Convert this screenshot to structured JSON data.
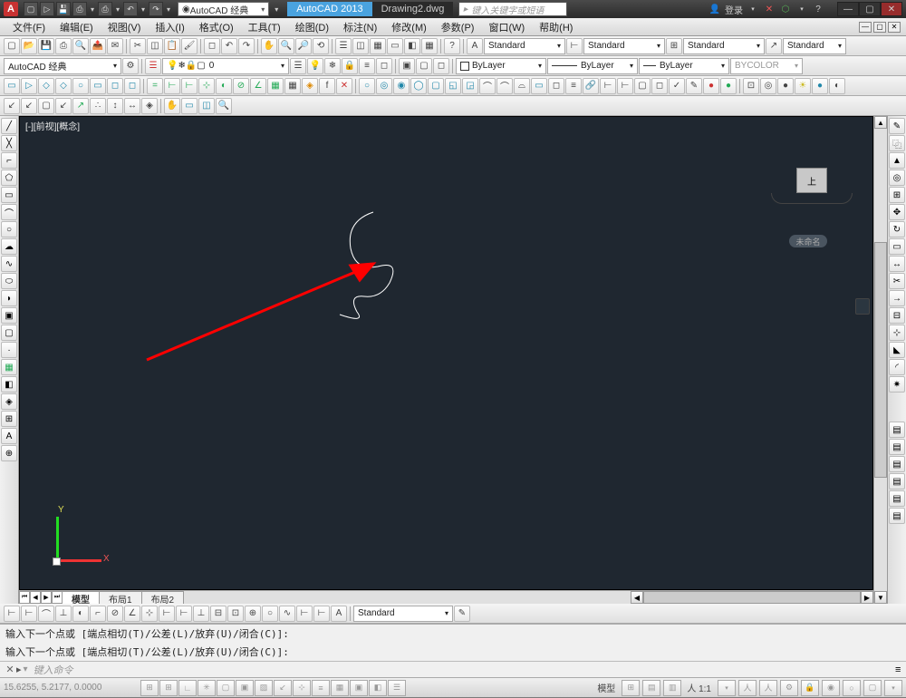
{
  "title": {
    "app": "AutoCAD 2013",
    "file": "Drawing2.dwg",
    "workspace": "AutoCAD 经典",
    "toolbar_title": "AutoCAD 经典",
    "search_placeholder": "键入关键字或短语",
    "login": "登录"
  },
  "menus": [
    "文件(F)",
    "编辑(E)",
    "视图(V)",
    "插入(I)",
    "格式(O)",
    "工具(T)",
    "绘图(D)",
    "标注(N)",
    "修改(M)",
    "参数(P)",
    "窗口(W)",
    "帮助(H)"
  ],
  "styles": {
    "text": "Standard",
    "dim": "Standard",
    "table": "Standard",
    "mleader": "Standard"
  },
  "layers": {
    "current": "0",
    "color": "ByLayer",
    "linetype": "ByLayer",
    "lineweight": "ByLayer",
    "plotstyle": "BYCOLOR"
  },
  "viewport": {
    "label": "[-][前视][概念]",
    "viewcube_face": "上",
    "unnamed_tag": "未命名",
    "ucs": {
      "x": "X",
      "y": "Y"
    }
  },
  "tabs": {
    "model": "模型",
    "layout1": "布局1",
    "layout2": "布局2"
  },
  "command": {
    "hist1": "输入下一个点或 [端点相切(T)/公差(L)/放弃(U)/闭合(C)]:",
    "hist2": "输入下一个点或 [端点相切(T)/公差(L)/放弃(U)/闭合(C)]:",
    "prompt": "▸",
    "placeholder": "键入命令"
  },
  "status": {
    "coords": "15.6255, 5.2177, 0.0000",
    "model": "模型",
    "scale": "人 1:1"
  },
  "annotation_style": "Standard"
}
